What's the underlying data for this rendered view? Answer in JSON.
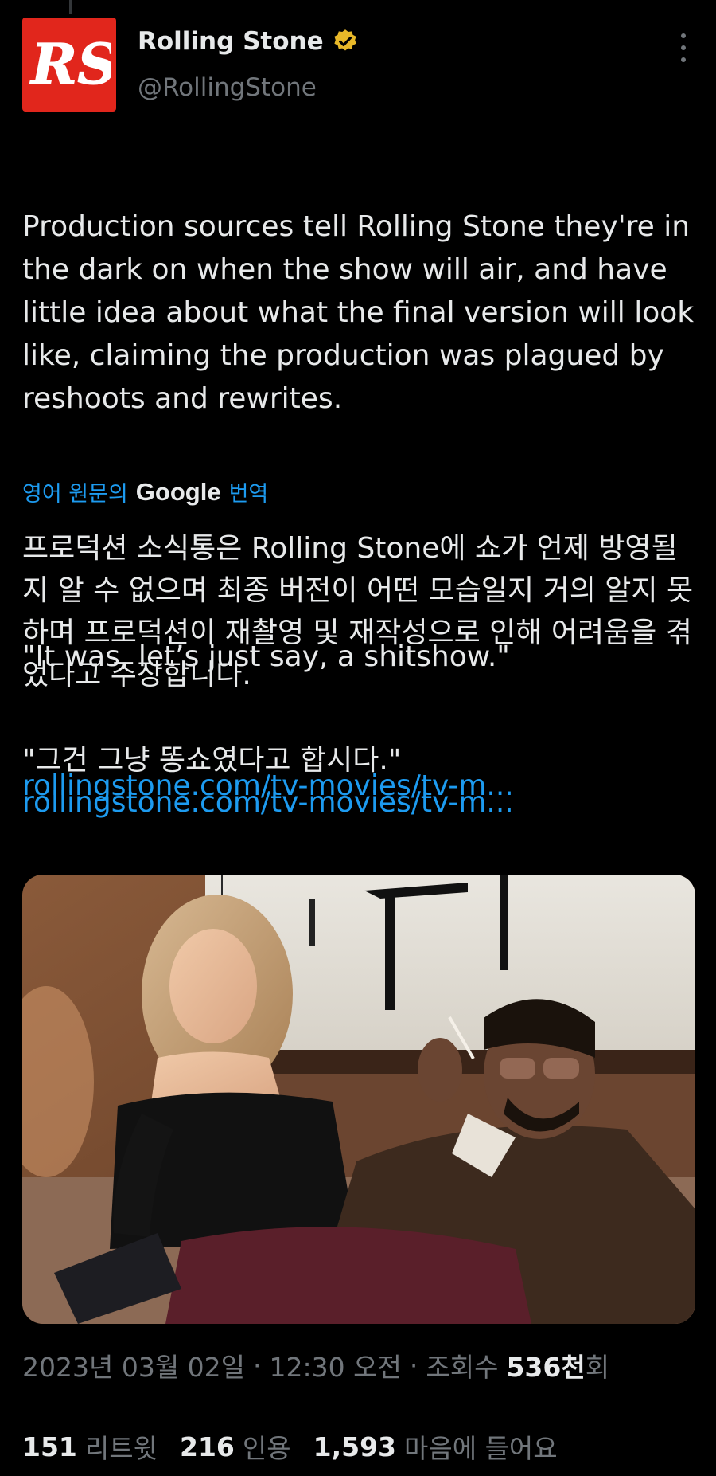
{
  "account": {
    "display_name": "Rolling Stone",
    "handle": "@RollingStone",
    "avatar_text": "RS",
    "verified_badge": "gold-verified-icon",
    "avatar_color": "#e1261c",
    "badge_color": "#e8b829"
  },
  "tweet": {
    "paragraph1": "Production sources tell Rolling Stone they're in the dark on when the show will air, and have little idea about what the final version will look like, claiming the production was plagued by reshoots and rewrites.",
    "paragraph2": "\"It was, let’s just say, a shitshow.\"",
    "link": "rollingstone.com/tv-movies/tv-m..."
  },
  "translation": {
    "prefix": "영어 원문의",
    "brand": "Google",
    "suffix": "번역",
    "paragraph1": "프로덕션 소식통은 Rolling Stone에 쇼가 언제 방영될지 알 수 없으며 최종 버전이 어떤 모습일지 거의 알지 못하며 프로덕션이 재촬영 및 재작성으로 인해 어려움을 겪었다고 주장합니다.",
    "paragraph2": "\"그건 그냥 똥쇼였다고 합시다.\"",
    "link": "rollingstone.com/tv-movies/tv-m..."
  },
  "meta": {
    "date": "2023년 03월 02일",
    "time": "12:30 오전",
    "views_label": "조회수",
    "views_count": "536천",
    "views_suffix": "회",
    "separator": "·"
  },
  "stats": {
    "retweets_count": "151",
    "retweets_label": "리트윗",
    "quotes_count": "216",
    "quotes_label": "인용",
    "likes_count": "1,593",
    "likes_label": "마음에 들어요"
  },
  "colors": {
    "background": "#000000",
    "text": "#e7e9ea",
    "secondary": "#71767b",
    "link": "#1d9bf0"
  }
}
